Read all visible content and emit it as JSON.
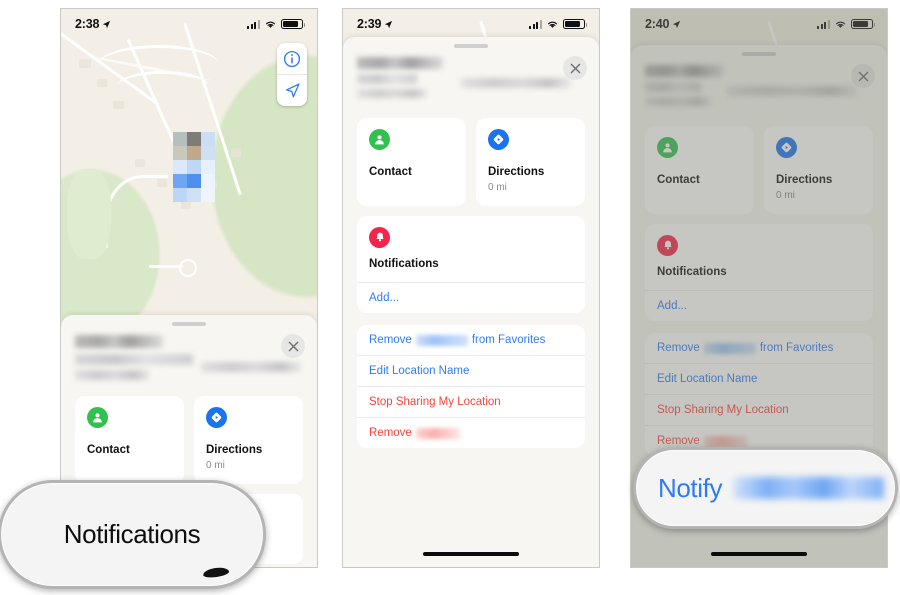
{
  "page": {
    "title": "Find My — Notifications setup, three iPhone screenshots",
    "background": "#ffffff"
  },
  "colors": {
    "blue_action": "#2e7bf6",
    "red_action": "#f8433c",
    "contact_green": "#30c14f",
    "directions_blue": "#1a73f0",
    "notifications_red": "#f4244c",
    "sheet_bg": "#f7f6f2",
    "card_bg": "#ffffff",
    "map_land": "#f3efe6",
    "map_park": "#d9e8c8",
    "dim_overlay": "rgba(120,122,110,0.42)"
  },
  "phones": [
    {
      "id": "phone-1",
      "status_bar": {
        "time": "2:38",
        "location_icon": "location-arrow-icon",
        "signal_icon": "cellular-bars-icon",
        "wifi_icon": "wifi-icon",
        "battery_icon": "battery-icon"
      },
      "map": {
        "visible": true,
        "info_button_icon": "info-circle-icon",
        "locate_button_icon": "location-arrow-icon"
      },
      "sheet": {
        "state": "peek",
        "grabber": true,
        "close_icon": "close-x-icon",
        "title_redacted": true,
        "subtitle_redacted": true,
        "cards": [
          {
            "icon": "contact-person-icon",
            "label": "Contact",
            "sub": ""
          },
          {
            "icon": "directions-arrow-icon",
            "label": "Directions",
            "sub": "0 mi"
          }
        ]
      },
      "magnifier": {
        "label": "Notifications",
        "cursor": true
      }
    },
    {
      "id": "phone-2",
      "status_bar": {
        "time": "2:39",
        "location_icon": "location-arrow-icon",
        "signal_icon": "cellular-bars-icon",
        "wifi_icon": "wifi-icon",
        "battery_icon": "battery-icon"
      },
      "map": {
        "visible": false
      },
      "dimmed": false,
      "sheet": {
        "state": "full",
        "grabber": true,
        "close_icon": "close-x-icon",
        "title_redacted": true,
        "subtitle_redacted": true,
        "cards": [
          {
            "icon": "contact-person-icon",
            "label": "Contact",
            "sub": ""
          },
          {
            "icon": "directions-arrow-icon",
            "label": "Directions",
            "sub": "0 mi"
          }
        ],
        "notifications": {
          "icon": "bell-icon",
          "label": "Notifications",
          "add_label": "Add..."
        },
        "actions": [
          {
            "prefix": "Remove",
            "redacted": true,
            "suffix": "from Favorites",
            "style": "blue"
          },
          {
            "prefix": "Edit Location Name",
            "redacted": false,
            "suffix": "",
            "style": "blue"
          },
          {
            "prefix": "Stop Sharing My Location",
            "redacted": false,
            "suffix": "",
            "style": "red"
          },
          {
            "prefix": "Remove",
            "redacted": true,
            "suffix": "",
            "style": "red"
          }
        ]
      },
      "home_indicator": true
    },
    {
      "id": "phone-3",
      "status_bar": {
        "time": "2:40",
        "location_icon": "location-arrow-icon",
        "signal_icon": "cellular-bars-icon",
        "wifi_icon": "wifi-icon",
        "battery_icon": "battery-icon"
      },
      "map": {
        "visible": false
      },
      "dimmed": true,
      "sheet": {
        "state": "full",
        "grabber": true,
        "close_icon": "close-x-icon",
        "title_redacted": true,
        "subtitle_redacted": true,
        "cards": [
          {
            "icon": "contact-person-icon",
            "label": "Contact",
            "sub": ""
          },
          {
            "icon": "directions-arrow-icon",
            "label": "Directions",
            "sub": "0 mi"
          }
        ],
        "notifications": {
          "icon": "bell-icon",
          "label": "Notifications",
          "add_label": "Add..."
        },
        "actions": [
          {
            "prefix": "Remove",
            "redacted": true,
            "suffix": "from Favorites",
            "style": "blue"
          },
          {
            "prefix": "Edit Location Name",
            "redacted": false,
            "suffix": "",
            "style": "blue"
          },
          {
            "prefix": "Stop Sharing My Location",
            "redacted": false,
            "suffix": "",
            "style": "red"
          },
          {
            "prefix": "Remove",
            "redacted": true,
            "suffix": "",
            "style": "red"
          }
        ]
      },
      "magnifier": {
        "label": "Notify",
        "redacted_name": true
      },
      "home_indicator": true
    }
  ]
}
